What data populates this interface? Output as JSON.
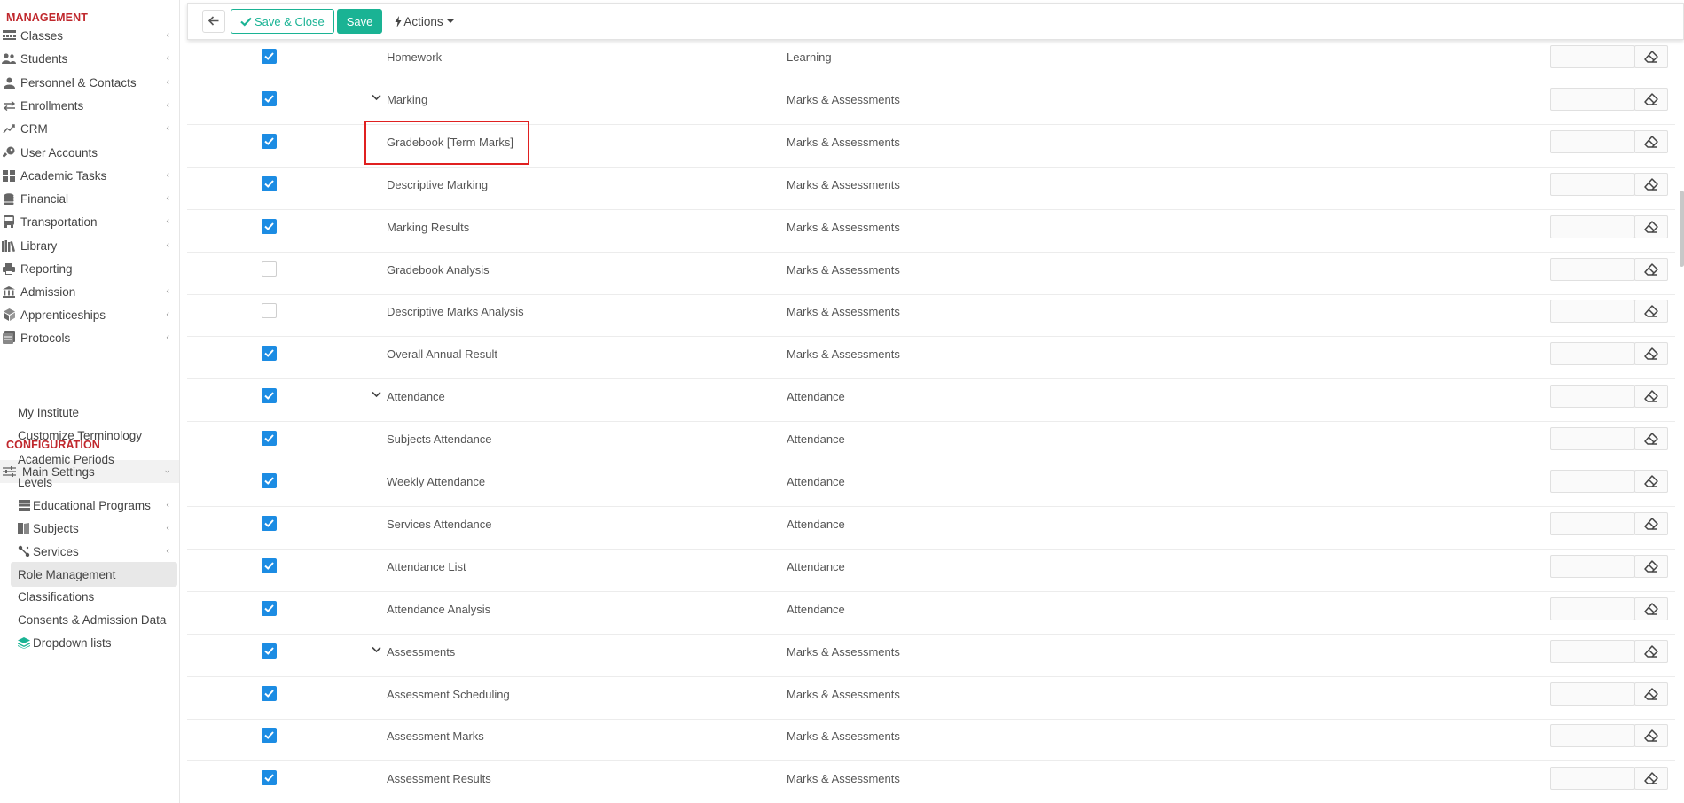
{
  "sidebar": {
    "management_title": "MANAGEMENT",
    "configuration_title": "CONFIGURATION",
    "management_items": [
      {
        "label": "Classes",
        "icon": "classes-icon",
        "chevron": true
      },
      {
        "label": "Students",
        "icon": "students-icon",
        "chevron": true
      },
      {
        "label": "Personnel & Contacts",
        "icon": "personnel-icon",
        "chevron": true
      },
      {
        "label": "Enrollments",
        "icon": "enrollments-icon",
        "chevron": true
      },
      {
        "label": "CRM",
        "icon": "crm-icon",
        "chevron": true
      },
      {
        "label": "User Accounts",
        "icon": "key-icon",
        "chevron": false
      },
      {
        "label": "Academic Tasks",
        "icon": "tasks-icon",
        "chevron": true
      },
      {
        "label": "Financial",
        "icon": "coins-icon",
        "chevron": true
      },
      {
        "label": "Transportation",
        "icon": "bus-icon",
        "chevron": true
      },
      {
        "label": "Library",
        "icon": "library-icon",
        "chevron": true
      },
      {
        "label": "Reporting",
        "icon": "print-icon",
        "chevron": false
      },
      {
        "label": "Admission",
        "icon": "bank-icon",
        "chevron": true
      },
      {
        "label": "Apprenticeships",
        "icon": "cube-icon",
        "chevron": true
      },
      {
        "label": "Protocols",
        "icon": "protocols-icon",
        "chevron": true
      }
    ],
    "main_settings": {
      "label": "Main Settings",
      "icon": "sliders-icon"
    },
    "config_items": [
      {
        "label": "My Institute",
        "icon": "",
        "chevron": false
      },
      {
        "label": "Customize Terminology",
        "icon": "",
        "chevron": false
      },
      {
        "label": "Academic Periods",
        "icon": "",
        "chevron": false
      },
      {
        "label": "Levels",
        "icon": "",
        "chevron": false
      },
      {
        "label": "Educational Programs",
        "icon": "programs-icon",
        "chevron": true
      },
      {
        "label": "Subjects",
        "icon": "book-icon",
        "chevron": true
      },
      {
        "label": "Services",
        "icon": "services-icon",
        "chevron": true
      },
      {
        "label": "Role Management",
        "icon": "",
        "chevron": false,
        "active": true
      },
      {
        "label": "Classifications",
        "icon": "",
        "chevron": false
      },
      {
        "label": "Consents & Admission Data",
        "icon": "",
        "chevron": false
      },
      {
        "label": "Dropdown lists",
        "icon": "layers-icon",
        "chevron": false
      }
    ]
  },
  "toolbar": {
    "back_icon": "arrow-left-icon",
    "save_close_label": "Save & Close",
    "save_label": "Save",
    "actions_label": "Actions"
  },
  "colors": {
    "accent_green": "#1ab394",
    "checkbox_blue": "#1c8ce3",
    "section_red": "#c0282d",
    "highlight_red": "#e02020"
  },
  "rows": [
    {
      "module": "Homework",
      "group": "Learning",
      "checked": true,
      "expander": false
    },
    {
      "module": "Marking",
      "group": "Marks & Assessments",
      "checked": true,
      "expander": true
    },
    {
      "module": "Gradebook [Term Marks]",
      "group": "Marks & Assessments",
      "checked": true,
      "expander": false,
      "highlighted": true
    },
    {
      "module": "Descriptive Marking",
      "group": "Marks & Assessments",
      "checked": true,
      "expander": false
    },
    {
      "module": "Marking Results",
      "group": "Marks & Assessments",
      "checked": true,
      "expander": false
    },
    {
      "module": "Gradebook Analysis",
      "group": "Marks & Assessments",
      "checked": false,
      "expander": false
    },
    {
      "module": "Descriptive Marks Analysis",
      "group": "Marks & Assessments",
      "checked": false,
      "expander": false
    },
    {
      "module": "Overall Annual Result",
      "group": "Marks & Assessments",
      "checked": true,
      "expander": false
    },
    {
      "module": "Attendance",
      "group": "Attendance",
      "checked": true,
      "expander": true
    },
    {
      "module": "Subjects Attendance",
      "group": "Attendance",
      "checked": true,
      "expander": false
    },
    {
      "module": "Weekly Attendance",
      "group": "Attendance",
      "checked": true,
      "expander": false
    },
    {
      "module": "Services Attendance",
      "group": "Attendance",
      "checked": true,
      "expander": false
    },
    {
      "module": "Attendance List",
      "group": "Attendance",
      "checked": true,
      "expander": false
    },
    {
      "module": "Attendance Analysis",
      "group": "Attendance",
      "checked": true,
      "expander": false
    },
    {
      "module": "Assessments",
      "group": "Marks & Assessments",
      "checked": true,
      "expander": true
    },
    {
      "module": "Assessment Scheduling",
      "group": "Marks & Assessments",
      "checked": true,
      "expander": false
    },
    {
      "module": "Assessment Marks",
      "group": "Marks & Assessments",
      "checked": true,
      "expander": false
    },
    {
      "module": "Assessment Results",
      "group": "Marks & Assessments",
      "checked": true,
      "expander": false
    }
  ]
}
